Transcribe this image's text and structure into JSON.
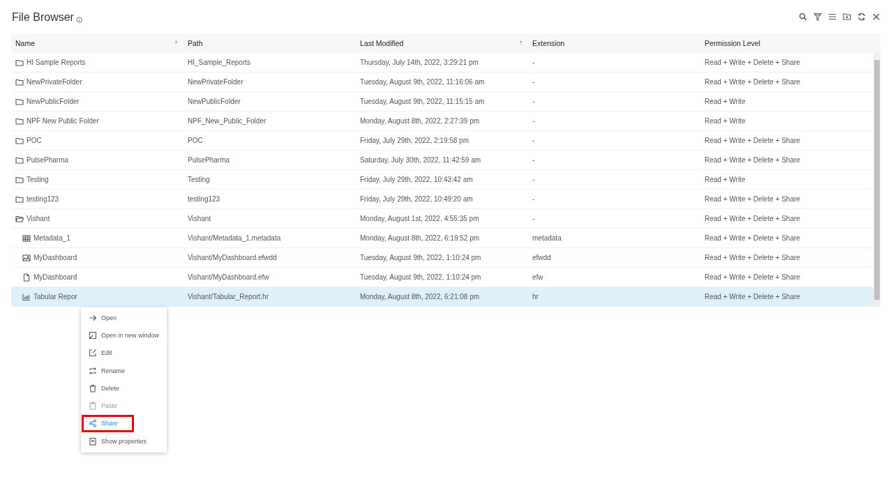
{
  "window": {
    "title": "File Browser"
  },
  "table": {
    "columns": [
      {
        "label": "Name",
        "sortable": true
      },
      {
        "label": "Path",
        "sortable": false
      },
      {
        "label": "Last Modified",
        "sortable": true
      },
      {
        "label": "Extension",
        "sortable": false
      },
      {
        "label": "Permission Level",
        "sortable": false
      }
    ],
    "rows": [
      {
        "kind": "folder",
        "name": "HI Sample Reports",
        "path": "HI_Sample_Reports",
        "modified": "Thursday, July 14th, 2022, 3:29:21 pm",
        "extension": "-",
        "permission": "Read + Write + Delete + Share",
        "selected": false
      },
      {
        "kind": "folder",
        "name": "NewPrivateFolder",
        "path": "NewPrivateFolder",
        "modified": "Tuesday, August 9th, 2022, 11:16:06 am",
        "extension": "-",
        "permission": "Read + Write + Delete + Share",
        "selected": false
      },
      {
        "kind": "folder",
        "name": "NewPublicFolder",
        "path": "NewPublicFolder",
        "modified": "Tuesday, August 9th, 2022, 11:15:15 am",
        "extension": "-",
        "permission": "Read + Write",
        "selected": false
      },
      {
        "kind": "folder",
        "name": "NPF New Public Folder",
        "path": "NPF_New_Public_Folder",
        "modified": "Monday, August 8th, 2022, 2:27:39 pm",
        "extension": "-",
        "permission": "Read + Write",
        "selected": false
      },
      {
        "kind": "folder",
        "name": "POC",
        "path": "POC",
        "modified": "Friday, July 29th, 2022, 2:19:58 pm",
        "extension": "-",
        "permission": "Read + Write + Delete + Share",
        "selected": false
      },
      {
        "kind": "folder",
        "name": "PulsePharma",
        "path": "PulsePharma",
        "modified": "Saturday, July 30th, 2022, 11:42:59 am",
        "extension": "-",
        "permission": "Read + Write + Delete + Share",
        "selected": false
      },
      {
        "kind": "folder",
        "name": "Testing",
        "path": "Testing",
        "modified": "Friday, July 29th, 2022, 10:43:42 am",
        "extension": "-",
        "permission": "Read + Write",
        "selected": false
      },
      {
        "kind": "folder",
        "name": "testing123",
        "path": "testing123",
        "modified": "Friday, July 29th, 2022, 10:49:20 am",
        "extension": "-",
        "permission": "Read + Write + Delete + Share",
        "selected": false
      },
      {
        "kind": "folder",
        "expanded": true,
        "name": "Vishant",
        "path": "Vishant",
        "modified": "Monday, August 1st, 2022, 4:55:35 pm",
        "extension": "-",
        "permission": "Read + Write + Delete + Share",
        "selected": false,
        "children": [
          {
            "kind": "metadata",
            "name": "Metadata_1",
            "path": "Vishant/Metadata_1.metadata",
            "modified": "Monday, August 8th, 2022, 6:19:52 pm",
            "extension": "metadata",
            "permission": "Read + Write + Delete + Share",
            "selected": false
          },
          {
            "kind": "dashboard",
            "name": "MyDashboard",
            "path": "Vishant/MyDashboard.efwdd",
            "modified": "Tuesday, August 9th, 2022, 1:10:24 pm",
            "extension": "efwdd",
            "permission": "Read + Write + Delete + Share",
            "selected": false
          },
          {
            "kind": "file",
            "name": "MyDashboard",
            "path": "Vishant/MyDashboard.efw",
            "modified": "Tuesday, August 9th, 2022, 1:10:24 pm",
            "extension": "efw",
            "permission": "Read + Write + Delete + Share",
            "selected": false
          },
          {
            "kind": "report",
            "name": "Tabular Repor",
            "path": "Vishant/Tabular_Report.hr",
            "modified": "Monday, August 8th, 2022, 6:21:08 pm",
            "extension": "hr",
            "permission": "Read + Write + Delete + Share",
            "selected": true
          }
        ]
      }
    ]
  },
  "context_menu": {
    "items": [
      {
        "label": "Open",
        "disabled": false,
        "highlighted": false
      },
      {
        "label": "Open in new window",
        "disabled": false,
        "highlighted": false
      },
      {
        "label": "Edit",
        "disabled": false,
        "highlighted": false
      },
      {
        "label": "Rename",
        "disabled": false,
        "highlighted": false
      },
      {
        "label": "Delete",
        "disabled": false,
        "highlighted": false
      },
      {
        "label": "Paste",
        "disabled": true,
        "highlighted": false
      },
      {
        "label": "Share",
        "disabled": false,
        "highlighted": true
      },
      {
        "label": "Show properties",
        "disabled": false,
        "highlighted": false
      }
    ]
  }
}
